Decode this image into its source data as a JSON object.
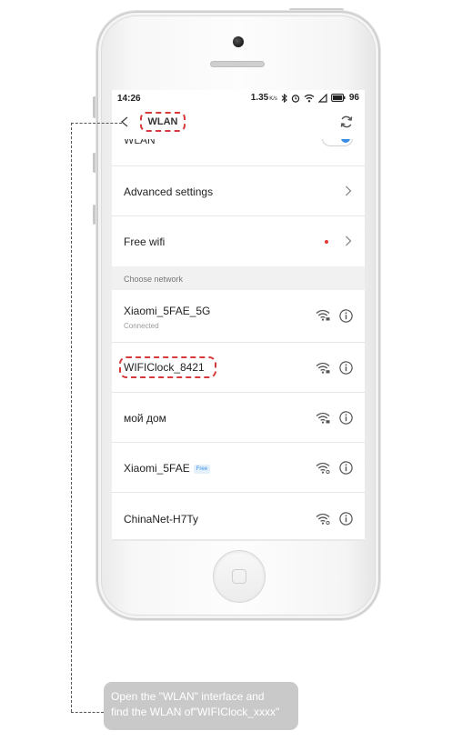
{
  "status_bar": {
    "time": "14:26",
    "speed": "1.35",
    "speed_unit": "K/s",
    "battery": "96"
  },
  "header": {
    "title": "WLAN"
  },
  "settings": {
    "wlan_label": "WLAN",
    "advanced_label": "Advanced settings",
    "free_wifi_label": "Free wifi"
  },
  "section": {
    "choose_network": "Choose network"
  },
  "networks": [
    {
      "name": "Xiaomi_5FAE_5G",
      "status": "Connected",
      "icon": "wifi-locked-icon"
    },
    {
      "name": "WIFIClock_8421",
      "icon": "wifi-locked-icon"
    },
    {
      "name": "мой дом",
      "icon": "wifi-locked-icon"
    },
    {
      "name": "Xiaomi_5FAE",
      "badge": "Free",
      "icon": "wifi-open-icon"
    },
    {
      "name": "ChinaNet-H7Ty",
      "icon": "wifi-open-icon"
    }
  ],
  "callout": {
    "line1": "Open the \"WLAN\" interface and",
    "line2": "find the WLAN of\"WIFIClock_xxxx\""
  },
  "colors": {
    "highlight": "#d63a3a",
    "accent": "#3a8ee6",
    "red_dot": "#e53935",
    "callout_bg": "#c9c9c9"
  }
}
